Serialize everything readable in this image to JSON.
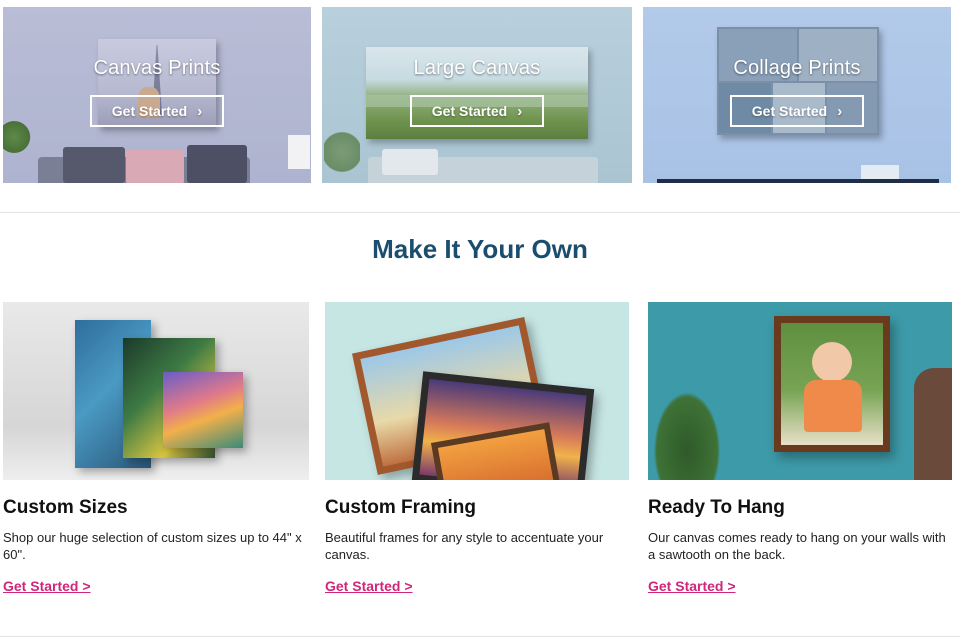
{
  "hero": [
    {
      "title": "Canvas Prints",
      "cta": "Get Started"
    },
    {
      "title": "Large Canvas",
      "cta": "Get Started"
    },
    {
      "title": "Collage Prints",
      "cta": "Get Started"
    }
  ],
  "section": {
    "title": "Make It Your Own"
  },
  "features": [
    {
      "title": "Custom Sizes",
      "description": "Shop our huge selection of custom sizes up to 44\" x 60\".",
      "link": "Get Started >"
    },
    {
      "title": "Custom Framing",
      "description": "Beautiful frames for any style to accentuate your canvas.",
      "link": "Get Started >"
    },
    {
      "title": "Ready To Hang",
      "description": "Our canvas comes ready to hang on your walls with a sawtooth on the back.",
      "link": "Get Started >"
    }
  ],
  "colors": {
    "heading": "#1b4d6f",
    "link": "#d0267a"
  },
  "icons": {
    "cta_chevron": "chevron-right-icon"
  }
}
